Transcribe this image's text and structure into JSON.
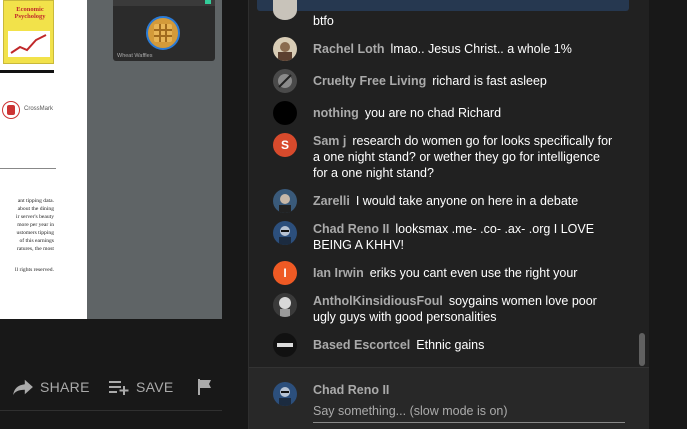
{
  "document": {
    "journal_title": "Economic Psychology",
    "crossmark_label": "CrossMark",
    "text_lines": [
      "ant tipping data.",
      "about the dining",
      "ir server's beauty",
      "more per year in",
      "ustomers tipping",
      "of this earnings",
      "ratures, the most"
    ],
    "rights_line": "ll rights reserved."
  },
  "thumbnail": {
    "caption": "Wheat Waffles"
  },
  "actions": {
    "share_label": "SHARE",
    "save_label": "SAVE"
  },
  "chat": {
    "pinned_continuation": "btfo",
    "messages": [
      {
        "author": "Rachel Loth",
        "text": "lmao.. Jesus Christ.. a whole 1%",
        "avatar_color": "#c9b8a0",
        "avatar_letter": ""
      },
      {
        "author": "Cruelty Free Living",
        "text": "richard is fast asleep",
        "avatar_color": "#5a5a5a",
        "avatar_letter": ""
      },
      {
        "author": "nothing",
        "text": "you are no chad Richard",
        "avatar_color": "#000000",
        "avatar_letter": ""
      },
      {
        "author": "Sam j",
        "text": "research do women go for looks specifically for a one night stand? or wether they go for intelligence for a one night stand?",
        "avatar_color": "#d84a2c",
        "avatar_letter": "S"
      },
      {
        "author": "Zarelli",
        "text": "I would take anyone on here in a debate",
        "avatar_color": "#3a5a7a",
        "avatar_letter": ""
      },
      {
        "author": "Chad Reno II",
        "text": "looksmax .me- .co- .ax- .org I LOVE BEING A KHHV!",
        "avatar_color": "#2c4f7c",
        "avatar_letter": ""
      },
      {
        "author": "Ian Irwin",
        "text": "eriks you cant even use the right your",
        "avatar_color": "#ef5a24",
        "avatar_letter": "I"
      },
      {
        "author": "AntholKinsidiousFoul",
        "text": "soygains women love poor ugly guys with good personalities",
        "avatar_color": "#6b6b6b",
        "avatar_letter": ""
      },
      {
        "author": "Based Escortcel",
        "text": "Ethnic gains",
        "avatar_color": "#111111",
        "avatar_letter": ""
      }
    ],
    "input_author": "Chad Reno II",
    "input_placeholder": "Say something... (slow mode is on)"
  }
}
